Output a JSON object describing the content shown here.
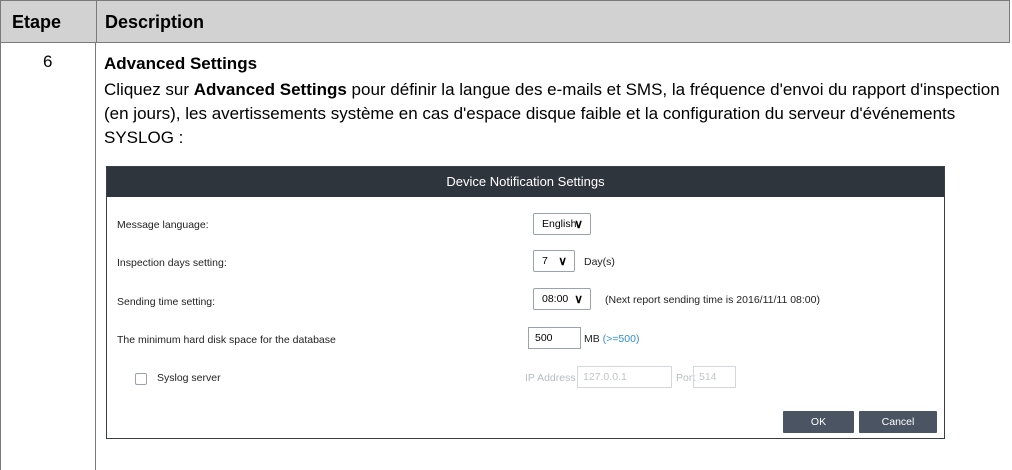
{
  "table": {
    "headers": [
      "Etape",
      "Description"
    ],
    "step_number": "6",
    "step_title": "Advanced Settings",
    "desc_prefix": "Cliquez sur ",
    "desc_bold": "Advanced Settings",
    "desc_suffix": " pour définir la langue des e-mails et SMS, la fréquence d'envoi du rapport d'inspection (en jours), les avertissements système en cas d'espace disque faible et la configuration du serveur d'événements SYSLOG :"
  },
  "dialog": {
    "title": "Device Notification Settings",
    "message_language": {
      "label": "Message language:",
      "value": "English"
    },
    "inspection_days": {
      "label": "Inspection days setting:",
      "value": "7",
      "suffix": "Day(s)"
    },
    "sending_time": {
      "label": "Sending time setting:",
      "value": "08:00",
      "note": "(Next report sending time is 2016/11/11 08:00)"
    },
    "min_disk": {
      "label": "The minimum hard disk space for the database",
      "value": "500",
      "unit": "MB",
      "hint": "(>=500)"
    },
    "syslog": {
      "label": "Syslog server",
      "checked": false,
      "ip_label": "IP Address",
      "ip_value": "127.0.0.1",
      "port_label": "Port",
      "port_value": "514"
    },
    "ok_label": "OK",
    "cancel_label": "Cancel"
  },
  "icons": {
    "dropdown": "double-chevron-down-icon"
  },
  "colors": {
    "titlebar": "#2f353d",
    "button": "#4a5462",
    "hint": "#2e8fd0",
    "header_bg": "#d2d2d2"
  }
}
